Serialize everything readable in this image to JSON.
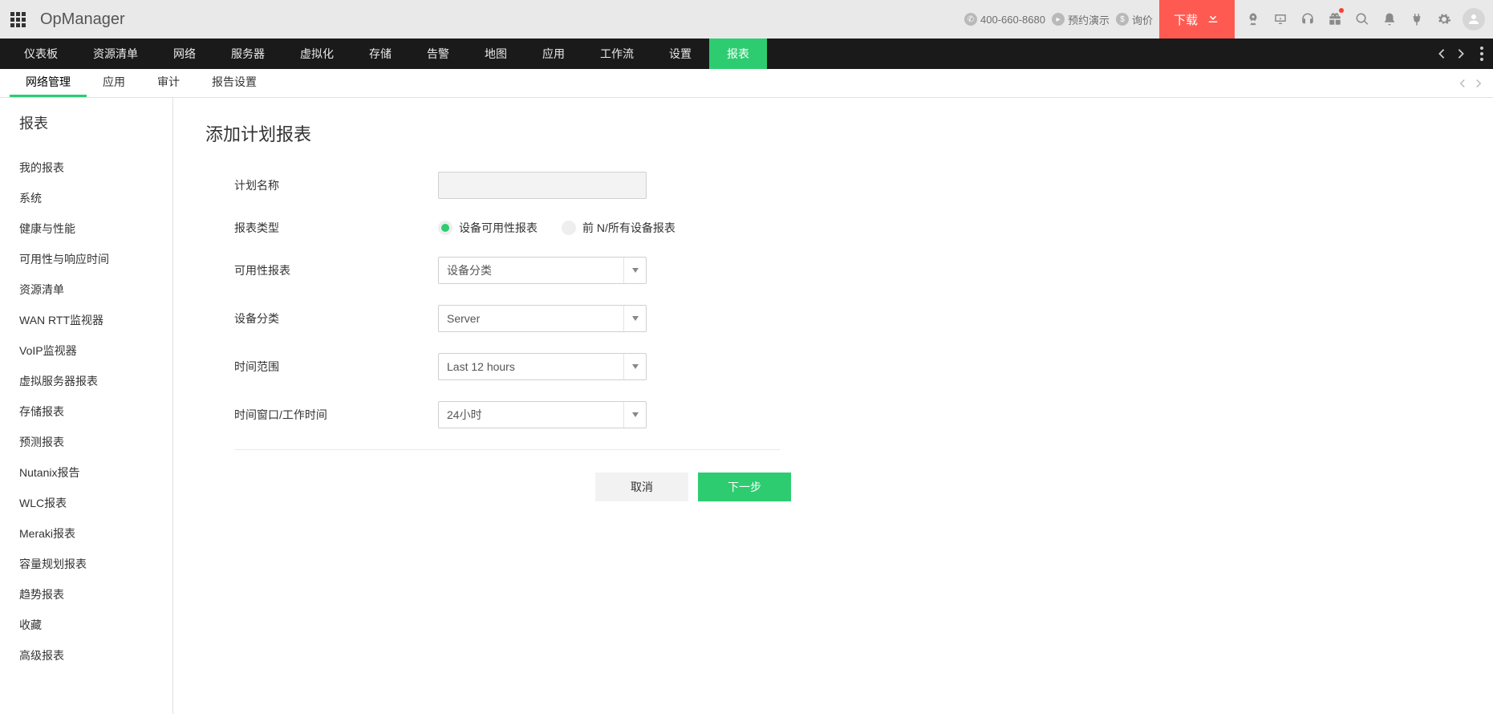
{
  "brand": "OpManager",
  "topbar": {
    "phone": "400-660-8680",
    "demo": "预约演示",
    "quote": "询价",
    "download": "下载"
  },
  "mainnav": {
    "items": [
      "仪表板",
      "资源清单",
      "网络",
      "服务器",
      "虚拟化",
      "存储",
      "告警",
      "地图",
      "应用",
      "工作流",
      "设置",
      "报表"
    ],
    "active_index": 11
  },
  "subnav": {
    "items": [
      "网络管理",
      "应用",
      "审计",
      "报告设置"
    ],
    "active_index": 0
  },
  "sidebar": {
    "title": "报表",
    "links": [
      "我的报表",
      "系统",
      "健康与性能",
      "可用性与响应时间",
      "资源清单",
      "WAN RTT监视器",
      "VoIP监视器",
      "虚拟服务器报表",
      "存储报表",
      "预测报表",
      "Nutanix报告",
      "WLC报表",
      "Meraki报表",
      "容量规划报表",
      "趋势报表",
      "收藏",
      "高级报表"
    ]
  },
  "page": {
    "title": "添加计划报表"
  },
  "form": {
    "plan_name_label": "计划名称",
    "report_type_label": "报表类型",
    "radio_a": "设备可用性报表",
    "radio_b": "前 N/所有设备报表",
    "availability_label": "可用性报表",
    "availability_value": "设备分类",
    "device_category_label": "设备分类",
    "device_category_value": "Server",
    "time_range_label": "时间范围",
    "time_range_value": "Last 12 hours",
    "time_window_label": "时间窗口/工作时间",
    "time_window_value": "24小时",
    "cancel": "取消",
    "next": "下一步"
  }
}
